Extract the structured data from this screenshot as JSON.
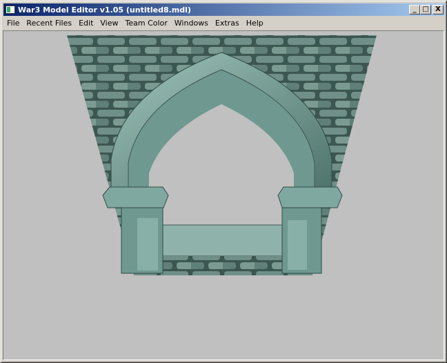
{
  "window": {
    "title": "War3 Model Editor v1.05 (untitled8.mdl)",
    "minimize": "_",
    "maximize": "□",
    "close": "X"
  },
  "menu": [
    "File",
    "Recent Files",
    "Edit",
    "View",
    "Team Color",
    "Windows",
    "Extras",
    "Help"
  ],
  "viewport": {
    "background": "#c0c0c0",
    "model": "stone-arch-wall"
  }
}
